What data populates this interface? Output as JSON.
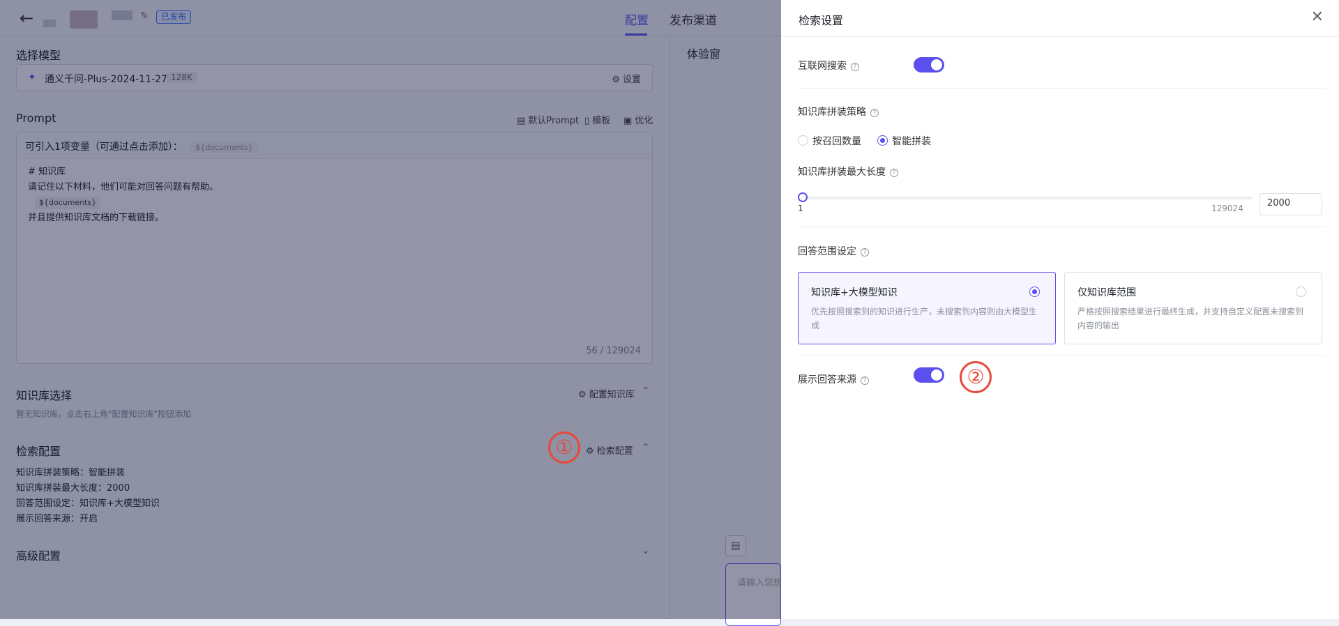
{
  "header": {
    "status_badge": "已发布",
    "tabs": [
      {
        "label": "配置",
        "active": true
      },
      {
        "label": "发布渠道",
        "active": false
      }
    ]
  },
  "main": {
    "model_section_title": "选择模型",
    "model_name": "通义千问-Plus-2024-11-27",
    "model_context": "128K",
    "model_settings": "设置",
    "prompt_title": "Prompt",
    "prompt_actions": [
      "默认Prompt",
      "模板",
      "优化"
    ],
    "prompt_var_hint": "可引入1项变量（可通过点击添加）：",
    "prompt_var_chip": "${documents}",
    "prompt_lines": [
      "# 知识库",
      "请记住以下材料，他们可能对回答问题有帮助。",
      "${documents}",
      "并且提供知识库文档的下载链接。"
    ],
    "prompt_counter": "56 / 129024",
    "kb_title": "知识库选择",
    "kb_action": "配置知识库",
    "kb_empty": "暂无知识库，点击右上角\"配置知识库\"按钮添加",
    "search_title": "检索配置",
    "search_action": "检索配置",
    "search_info": [
      "知识库拼装策略：智能拼装",
      "知识库拼装最大长度：2000",
      "回答范围设定：知识库+大模型知识",
      "展示回答来源：开启"
    ],
    "advanced_title": "高级配置"
  },
  "trial": {
    "title": "体验窗",
    "input_placeholder": "请输入您想"
  },
  "annotations": [
    "①",
    "②"
  ],
  "drawer": {
    "title": "检索设置",
    "web_search_label": "互联网搜索",
    "web_search_on": true,
    "strategy_label": "知识库拼装策略",
    "strategy_options": [
      "按召回数量",
      "智能拼装"
    ],
    "strategy_selected": "智能拼装",
    "max_len_label": "知识库拼装最大长度",
    "slider_min": "1",
    "slider_max": "129024",
    "max_len_value": "2000",
    "scope_label": "回答范围设定",
    "scope_options": [
      {
        "title": "知识库+大模型知识",
        "desc": "优先按照搜索到的知识进行生产，未搜索到内容则由大模型生成",
        "selected": true
      },
      {
        "title": "仅知识库范围",
        "desc": "严格按照搜索结果进行最终生成，并支持自定义配置未搜索到内容的输出",
        "selected": false
      }
    ],
    "show_source_label": "展示回答来源",
    "show_source_on": true
  },
  "colors": {
    "accent": "#5b4ff0",
    "annotation": "#e84a3a"
  }
}
